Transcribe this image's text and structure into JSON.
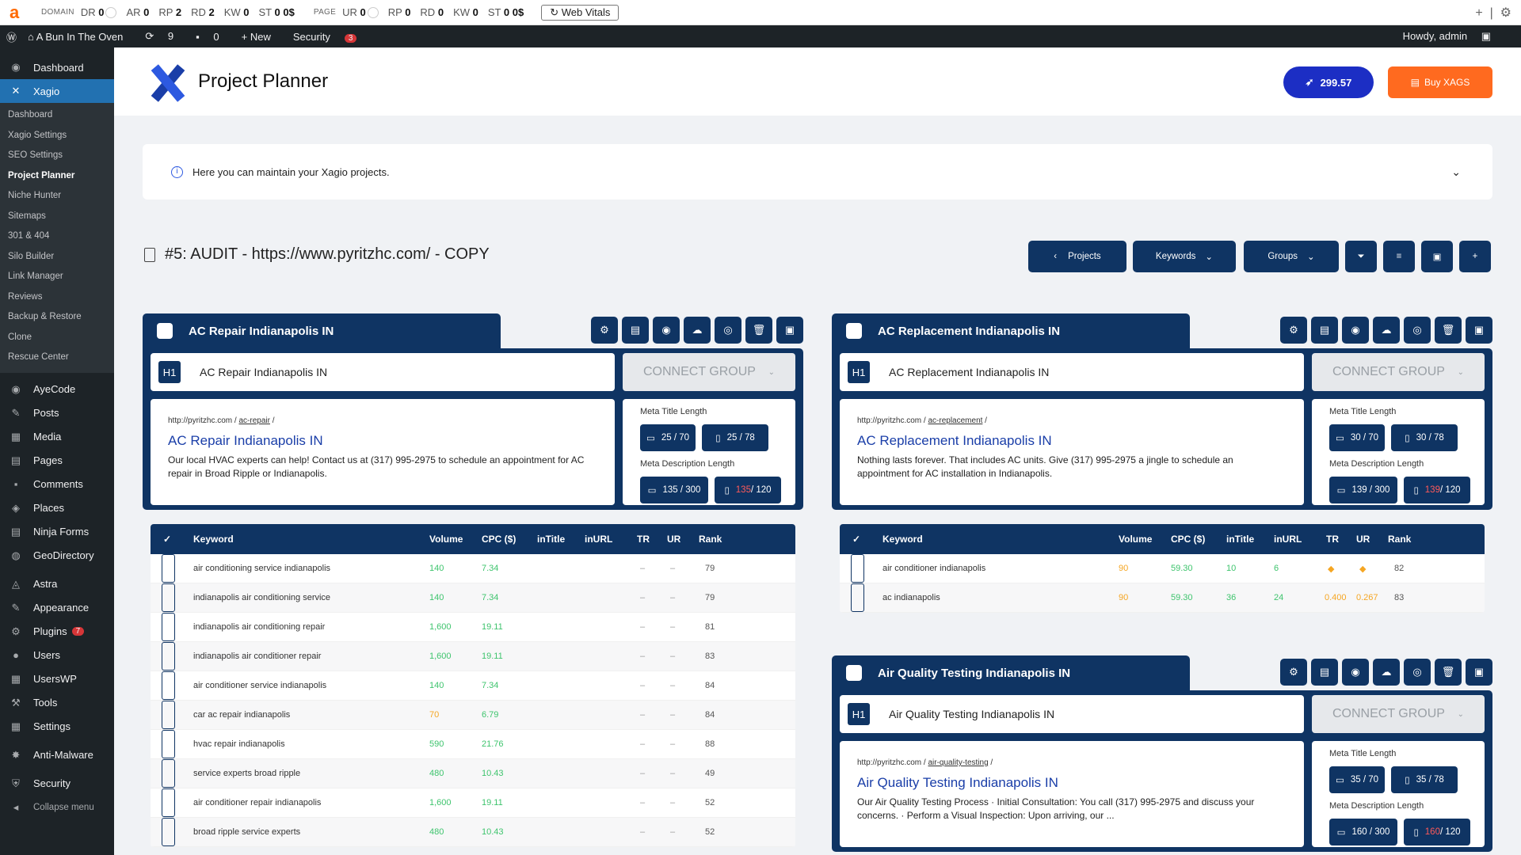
{
  "topbar": {
    "domain_label": "DOMAIN",
    "page_label": "PAGE",
    "domain_metrics": [
      {
        "k": "DR",
        "v": "0"
      },
      {
        "k": "AR",
        "v": "0"
      },
      {
        "k": "RP",
        "v": "2"
      },
      {
        "k": "RD",
        "v": "2"
      },
      {
        "k": "KW",
        "v": "0"
      },
      {
        "k": "ST",
        "v": "0 0$"
      }
    ],
    "page_metrics": [
      {
        "k": "UR",
        "v": "0"
      },
      {
        "k": "RP",
        "v": "0"
      },
      {
        "k": "RD",
        "v": "0"
      },
      {
        "k": "KW",
        "v": "0"
      },
      {
        "k": "ST",
        "v": "0 0$"
      }
    ],
    "web_vitals": "Web Vitals"
  },
  "wpbar": {
    "site": "A Bun In The Oven",
    "updates": "9",
    "comments": "0",
    "new": "New",
    "security": "Security",
    "security_count": "3",
    "howdy": "Howdy, admin"
  },
  "sidebar": {
    "dashboard": "Dashboard",
    "xagio": "Xagio",
    "sub": [
      "Dashboard",
      "Xagio Settings",
      "SEO Settings",
      "Project Planner",
      "Niche Hunter",
      "Sitemaps",
      "301 & 404",
      "Silo Builder",
      "Link Manager",
      "Reviews",
      "Backup & Restore",
      "Clone",
      "Rescue Center"
    ],
    "items": [
      "AyeCode",
      "Posts",
      "Media",
      "Pages",
      "Comments",
      "Places",
      "Ninja Forms",
      "GeoDirectory",
      "Astra",
      "Appearance",
      "Plugins",
      "Users",
      "UsersWP",
      "Tools",
      "Settings",
      "Anti-Malware",
      "Security",
      "Collapse menu"
    ],
    "plugins_count": "7"
  },
  "header": {
    "title": "Project Planner",
    "credits": "299.57",
    "buy": "Buy XAGS"
  },
  "info": {
    "text": "Here you can maintain your Xagio projects."
  },
  "project": {
    "title": "#5: AUDIT - https://www.pyritzhc.com/ - COPY",
    "btn_projects": "Projects",
    "btn_keywords": "Keywords",
    "btn_groups": "Groups"
  },
  "labels": {
    "connect": "CONNECT GROUP",
    "meta_title": "Meta Title Length",
    "meta_desc": "Meta Description Length",
    "h1": "H1"
  },
  "columns": [
    "Keyword",
    "Volume",
    "CPC ($)",
    "inTitle",
    "inURL",
    "TR",
    "UR",
    "Rank"
  ],
  "groups": [
    {
      "name": "AC Repair Indianapolis IN",
      "h1": "AC Repair Indianapolis IN",
      "url_base": "http://pyritzhc.com",
      "url_slug": "ac-repair",
      "serp_title": "AC Repair Indianapolis IN",
      "serp_desc": "Our local HVAC experts can help! Contact us at (317) 995-2975 to schedule an appointment for AC repair in Broad Ripple or Indianapolis.",
      "mt_desktop": "25 / 70",
      "mt_mobile": "25 / 78",
      "md_desktop": "135 / 300",
      "md_mobile_a": "135",
      "md_mobile_b": " / 120"
    },
    {
      "name": "AC Replacement Indianapolis IN",
      "h1": "AC Replacement Indianapolis IN",
      "url_base": "http://pyritzhc.com",
      "url_slug": "ac-replacement",
      "serp_title": "AC Replacement Indianapolis IN",
      "serp_desc": "Nothing lasts forever. That includes AC units. Give (317) 995-2975 a jingle to schedule an appointment for AC installation in Indianapolis.",
      "mt_desktop": "30 / 70",
      "mt_mobile": "30 / 78",
      "md_desktop": "139 / 300",
      "md_mobile_a": "139",
      "md_mobile_b": " / 120"
    },
    {
      "name": "Air Quality Testing Indianapolis IN",
      "h1": "Air Quality Testing Indianapolis IN",
      "url_base": "http://pyritzhc.com",
      "url_slug": "air-quality-testing",
      "serp_title": "Air Quality Testing Indianapolis IN",
      "serp_desc": "Our Air Quality Testing Process · Initial Consultation: You call (317) 995-2975 and discuss your concerns. · Perform a Visual Inspection: Upon arriving, our ...",
      "mt_desktop": "35 / 70",
      "mt_mobile": "35 / 78",
      "md_desktop": "160 / 300",
      "md_mobile_a": "160",
      "md_mobile_b": " / 120"
    }
  ],
  "kw1": [
    {
      "kw": "air conditioning service indianapolis",
      "vol": "140",
      "cpc": "7.34",
      "tr": "–",
      "ur": "–",
      "rank": "79",
      "vc": "green"
    },
    {
      "kw": "indianapolis air conditioning service",
      "vol": "140",
      "cpc": "7.34",
      "tr": "–",
      "ur": "–",
      "rank": "79",
      "vc": "green"
    },
    {
      "kw": "indianapolis air conditioning repair",
      "vol": "1,600",
      "cpc": "19.11",
      "tr": "–",
      "ur": "–",
      "rank": "81",
      "vc": "green"
    },
    {
      "kw": "indianapolis air conditioner repair",
      "vol": "1,600",
      "cpc": "19.11",
      "tr": "–",
      "ur": "–",
      "rank": "83",
      "vc": "green"
    },
    {
      "kw": "air conditioner service indianapolis",
      "vol": "140",
      "cpc": "7.34",
      "tr": "–",
      "ur": "–",
      "rank": "84",
      "vc": "green"
    },
    {
      "kw": "car ac repair indianapolis",
      "vol": "70",
      "cpc": "6.79",
      "tr": "–",
      "ur": "–",
      "rank": "84",
      "vc": "orange"
    },
    {
      "kw": "hvac repair indianapolis",
      "vol": "590",
      "cpc": "21.76",
      "tr": "–",
      "ur": "–",
      "rank": "88",
      "vc": "green"
    },
    {
      "kw": "service experts broad ripple",
      "vol": "480",
      "cpc": "10.43",
      "tr": "–",
      "ur": "–",
      "rank": "49",
      "vc": "green"
    },
    {
      "kw": "air conditioner repair indianapolis",
      "vol": "1,600",
      "cpc": "19.11",
      "tr": "–",
      "ur": "–",
      "rank": "52",
      "vc": "green"
    },
    {
      "kw": "broad ripple service experts",
      "vol": "480",
      "cpc": "10.43",
      "tr": "–",
      "ur": "–",
      "rank": "52",
      "vc": "green"
    }
  ],
  "kw2": [
    {
      "kw": "air conditioner indianapolis",
      "vol": "90",
      "cpc": "59.30",
      "intitle": "10",
      "inurl": "6",
      "tr": "",
      "ur": "",
      "rank": "82"
    },
    {
      "kw": "ac indianapolis",
      "vol": "90",
      "cpc": "59.30",
      "intitle": "36",
      "inurl": "24",
      "tr": "0.400",
      "ur": "0.267",
      "rank": "83"
    }
  ],
  "colors": {
    "navy": "#0f3463",
    "blue": "#1c2ec4",
    "orange": "#ff6a1f",
    "green": "#3ec46d",
    "amber": "#f5a623"
  }
}
